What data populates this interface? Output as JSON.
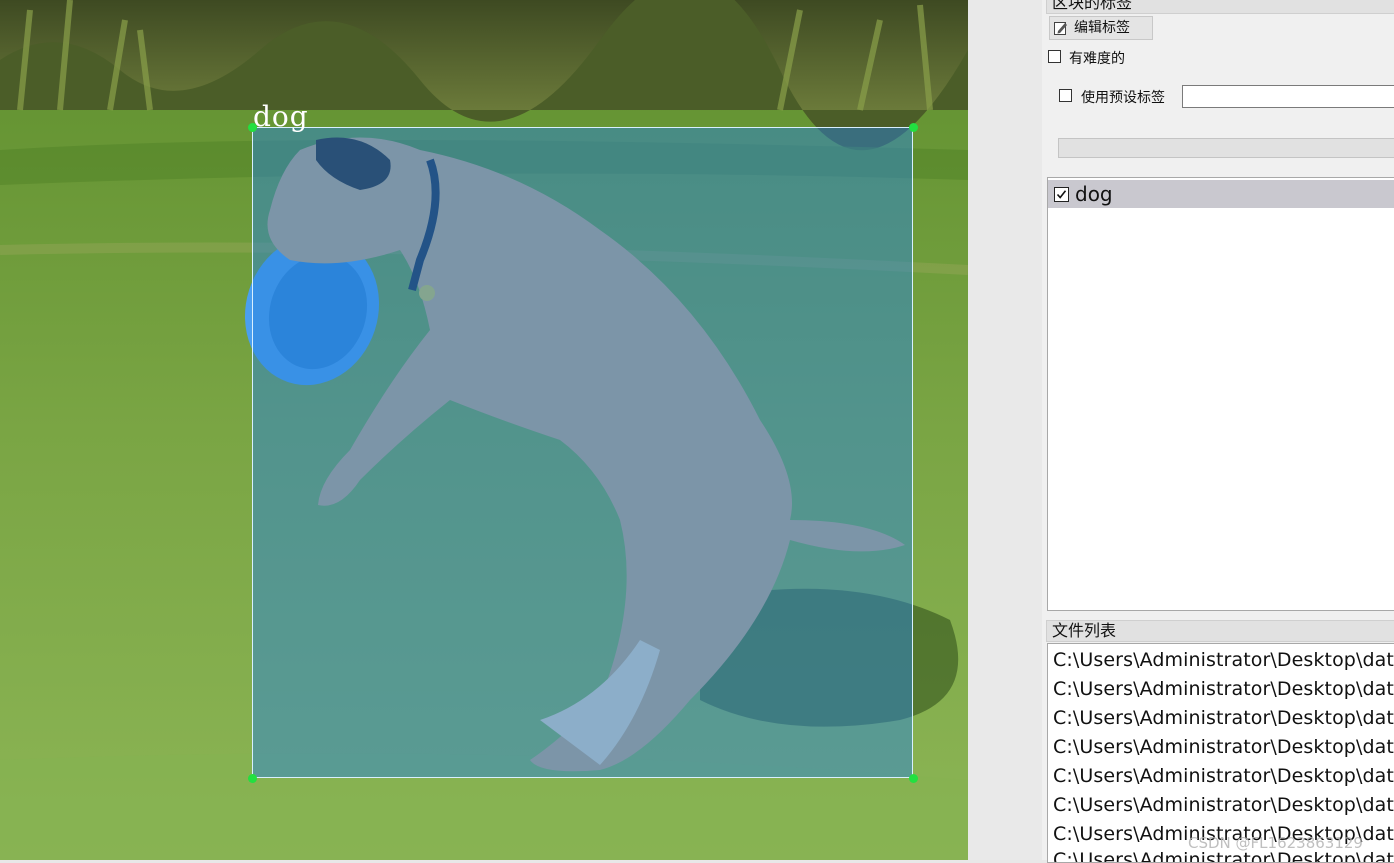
{
  "canvas": {
    "annotation": {
      "label": "dog"
    }
  },
  "dock": {
    "block_labels_title": "区块的标签",
    "edit_label_button": "编辑标签",
    "difficult_label": "有难度的",
    "use_preset_label": "使用预设标签",
    "preset_value": "",
    "labels": [
      {
        "name": "dog",
        "checked": true
      }
    ],
    "file_list_title": "文件列表",
    "files": [
      "C:\\Users\\Administrator\\Desktop\\dat",
      "C:\\Users\\Administrator\\Desktop\\dat",
      "C:\\Users\\Administrator\\Desktop\\dat",
      "C:\\Users\\Administrator\\Desktop\\dat",
      "C:\\Users\\Administrator\\Desktop\\dat",
      "C:\\Users\\Administrator\\Desktop\\dat",
      "C:\\Users\\Administrator\\Desktop\\dat",
      "C:\\Users\\Administrator\\Desktop\\dat"
    ]
  },
  "watermark": "CSDN @FL1623863129",
  "colors": {
    "bbox_fill": "#2882dc",
    "handle": "#22e040",
    "selected_row": "#c9c8cf"
  }
}
